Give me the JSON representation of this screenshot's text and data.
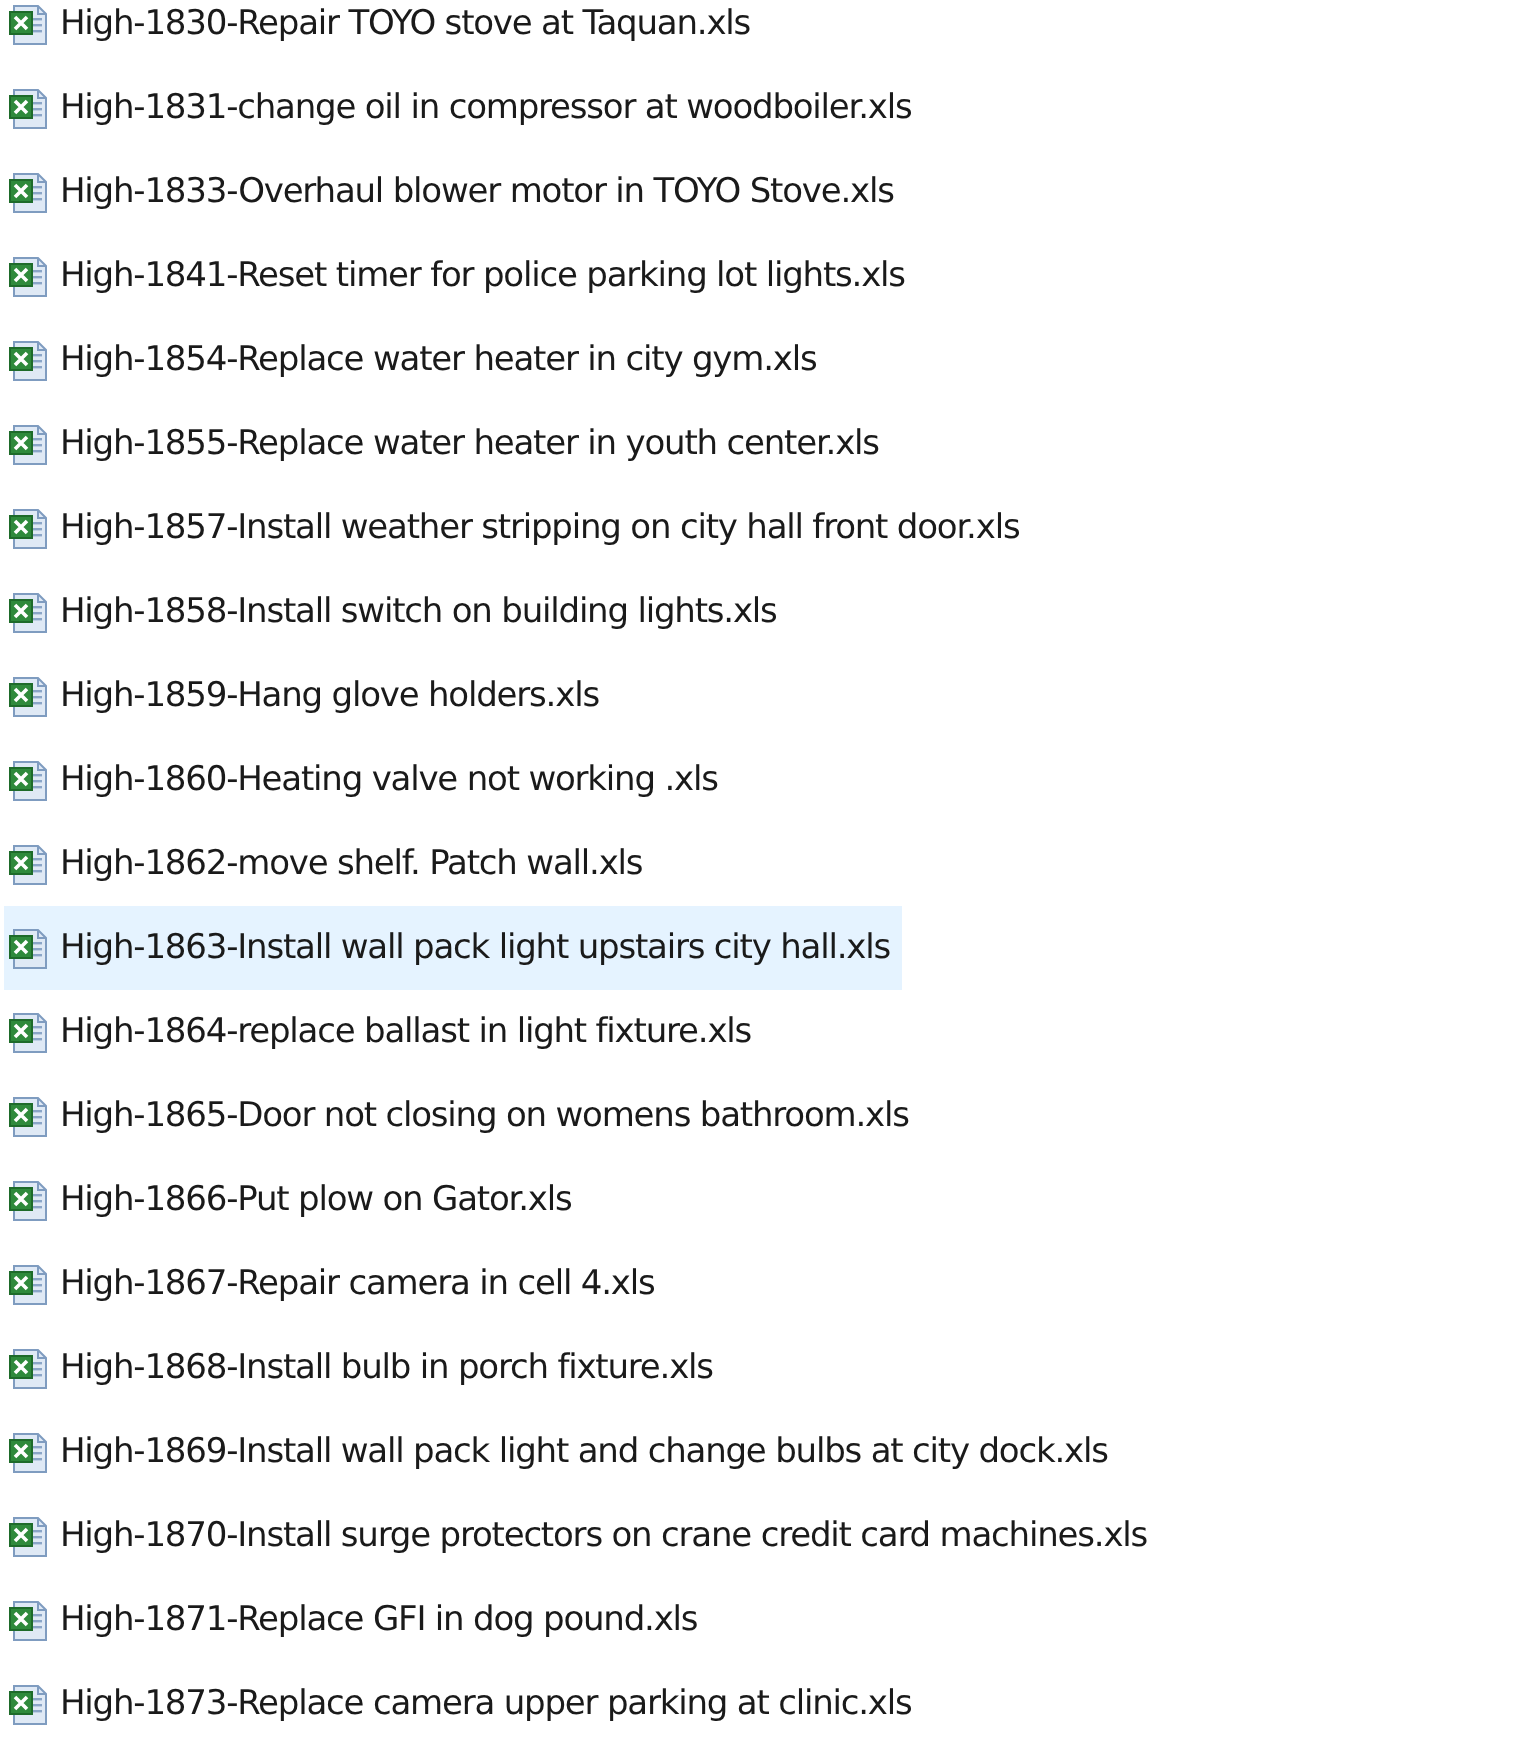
{
  "files": [
    {
      "name": "High-1830-Repair TOYO stove at Taquan.xls",
      "selected": false
    },
    {
      "name": "High-1831-change oil in compressor at woodboiler.xls",
      "selected": false
    },
    {
      "name": "High-1833-Overhaul blower motor in TOYO Stove.xls",
      "selected": false
    },
    {
      "name": "High-1841-Reset timer for police parking lot lights.xls",
      "selected": false
    },
    {
      "name": "High-1854-Replace water heater in city gym.xls",
      "selected": false
    },
    {
      "name": "High-1855-Replace water heater in youth center.xls",
      "selected": false
    },
    {
      "name": "High-1857-Install weather stripping on city hall front door.xls",
      "selected": false
    },
    {
      "name": "High-1858-Install switch on building lights.xls",
      "selected": false
    },
    {
      "name": "High-1859-Hang glove holders.xls",
      "selected": false
    },
    {
      "name": "High-1860-Heating valve not working .xls",
      "selected": false
    },
    {
      "name": "High-1862-move shelf. Patch wall.xls",
      "selected": false
    },
    {
      "name": "High-1863-Install wall pack light upstairs city hall.xls",
      "selected": true
    },
    {
      "name": "High-1864-replace ballast in light fixture.xls",
      "selected": false
    },
    {
      "name": "High-1865-Door not closing on womens bathroom.xls",
      "selected": false
    },
    {
      "name": "High-1866-Put plow on Gator.xls",
      "selected": false
    },
    {
      "name": "High-1867-Repair camera in cell 4.xls",
      "selected": false
    },
    {
      "name": "High-1868-Install bulb in porch fixture.xls",
      "selected": false
    },
    {
      "name": "High-1869-Install wall pack light and change bulbs at city dock.xls",
      "selected": false
    },
    {
      "name": "High-1870-Install surge protectors on crane credit card machines.xls",
      "selected": false
    },
    {
      "name": "High-1871-Replace GFI in dog pound.xls",
      "selected": false
    },
    {
      "name": "High-1873-Replace camera upper parking at clinic.xls",
      "selected": false
    }
  ]
}
